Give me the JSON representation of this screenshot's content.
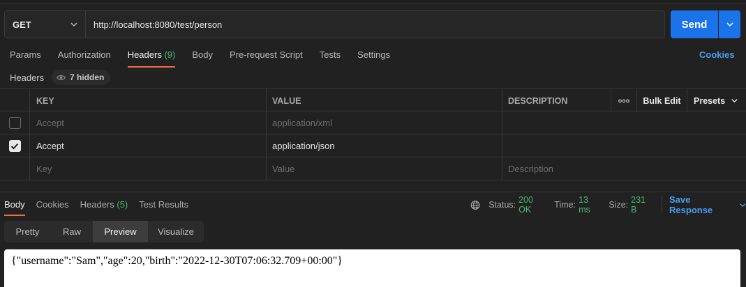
{
  "request": {
    "method": "GET",
    "url": "http://localhost:8080/test/person",
    "send_label": "Send"
  },
  "request_tabs": [
    {
      "label": "Params"
    },
    {
      "label": "Authorization"
    },
    {
      "label": "Headers",
      "count": "(9)",
      "active": true
    },
    {
      "label": "Body"
    },
    {
      "label": "Pre-request Script"
    },
    {
      "label": "Tests"
    },
    {
      "label": "Settings"
    }
  ],
  "cookies_label": "Cookies",
  "headers_section": {
    "label": "Headers",
    "hidden_label": "7 hidden"
  },
  "table": {
    "columns": {
      "key": "KEY",
      "value": "VALUE",
      "description": "DESCRIPTION"
    },
    "bulk_edit": "Bulk Edit",
    "presets": "Presets",
    "rows": [
      {
        "checked": false,
        "key": "Accept",
        "value": "application/xml",
        "description": ""
      },
      {
        "checked": true,
        "key": "Accept",
        "value": "application/json",
        "description": ""
      }
    ],
    "placeholder": {
      "key": "Key",
      "value": "Value",
      "description": "Description"
    }
  },
  "response_tabs": [
    {
      "label": "Body",
      "active": true
    },
    {
      "label": "Cookies"
    },
    {
      "label": "Headers",
      "count": "(5)"
    },
    {
      "label": "Test Results"
    }
  ],
  "status": {
    "status_label": "Status:",
    "status_value": "200 OK",
    "time_label": "Time:",
    "time_value": "13 ms",
    "size_label": "Size:",
    "size_value": "231 B",
    "save_response": "Save Response"
  },
  "view_modes": [
    "Pretty",
    "Raw",
    "Preview",
    "Visualize"
  ],
  "active_view": "Preview",
  "response_body": "{\"username\":\"Sam\",\"age\":20,\"birth\":\"2022-12-30T07:06:32.709+00:00\"}",
  "colors": {
    "accent_blue": "#1a73e8",
    "link_blue": "#4a9cf5",
    "tab_underline": "#f26b3a",
    "status_green": "#49b86c",
    "background": "#212121"
  }
}
